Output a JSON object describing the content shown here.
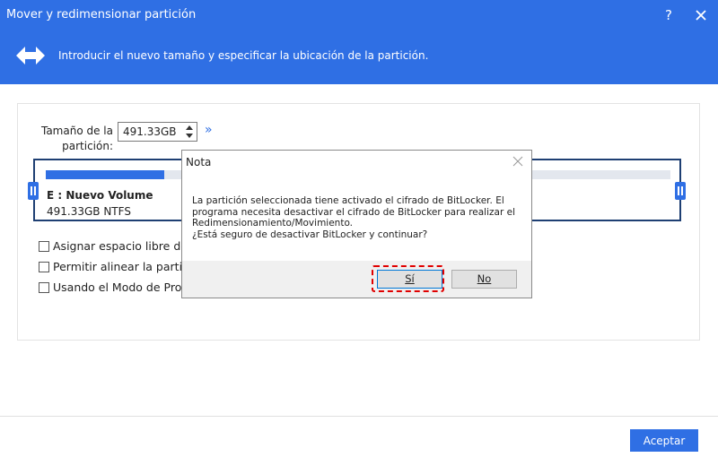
{
  "window": {
    "title": "Mover y redimensionar partición",
    "help": "?",
    "subtitle": "Introducir el nuevo tamaño y especificar la ubicación de la partición."
  },
  "size": {
    "label_line1": "Tamaño de la",
    "label_line2": "partición:",
    "value": "491.33GB"
  },
  "partition": {
    "name": "E : Nuevo Volume",
    "info": "491.33GB NTFS",
    "used_fraction": 0.19
  },
  "options": [
    "Asignar espacio libre de",
    "Permitir alinear la partic",
    "Usando el Modo de Prot"
  ],
  "footer": {
    "ok_label": "Aceptar"
  },
  "dialog": {
    "title": "Nota",
    "message_lines": [
      "La partición seleccionada tiene activado el cifrado de BitLocker. El",
      "programa necesita desactivar el cifrado de BitLocker para realizar el",
      "Redimensionamiento/Movimiento.",
      "¿Está seguro de desactivar BitLocker y continuar?"
    ],
    "yes_label": "Sí",
    "no_label": "No"
  },
  "colors": {
    "accent": "#2f6fe4",
    "border_dark": "#1e3f73",
    "highlight": "#e00000"
  }
}
